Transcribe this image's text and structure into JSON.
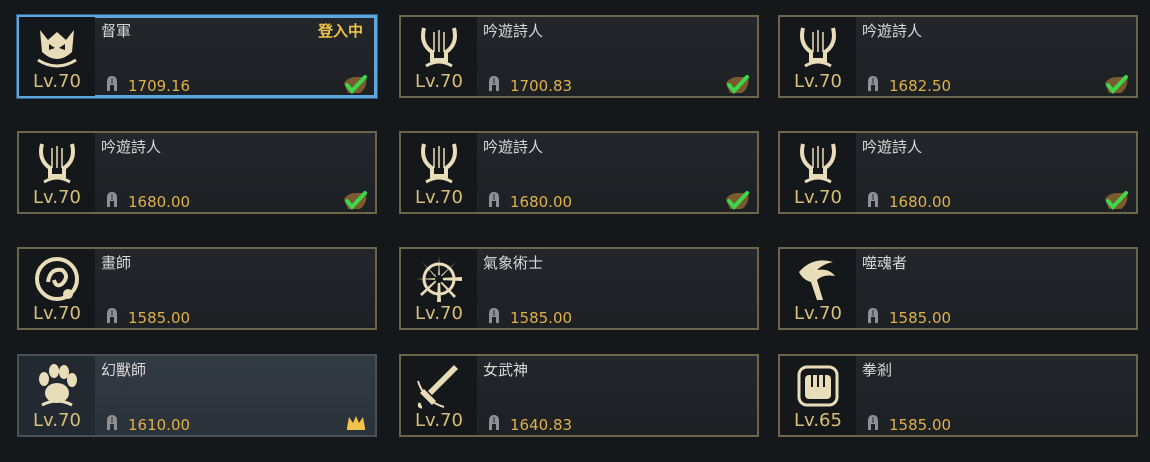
{
  "colors": {
    "background": "#15181a",
    "border_gold": "#6d6549",
    "border_selected": "#5fa6dc",
    "level_gold": "#d7bf78",
    "item_level_orange": "#e0b04a",
    "status_yellow": "#f0c24a",
    "check_green": "#3ed64a"
  },
  "characters": [
    {
      "class_name": "督軍",
      "level": "Lv.70",
      "item_level": "1709.16",
      "icon": "warlord-helm-icon",
      "status": "登入中",
      "selected": true,
      "highlight": false,
      "check": true,
      "crown": false
    },
    {
      "class_name": "吟遊詩人",
      "level": "Lv.70",
      "item_level": "1700.83",
      "icon": "lyre-icon",
      "status": "",
      "selected": false,
      "highlight": false,
      "check": true,
      "crown": false
    },
    {
      "class_name": "吟遊詩人",
      "level": "Lv.70",
      "item_level": "1682.50",
      "icon": "lyre-icon",
      "status": "",
      "selected": false,
      "highlight": false,
      "check": true,
      "crown": false
    },
    {
      "class_name": "吟遊詩人",
      "level": "Lv.70",
      "item_level": "1680.00",
      "icon": "lyre-icon",
      "status": "",
      "selected": false,
      "highlight": false,
      "check": true,
      "crown": false
    },
    {
      "class_name": "吟遊詩人",
      "level": "Lv.70",
      "item_level": "1680.00",
      "icon": "lyre-icon",
      "status": "",
      "selected": false,
      "highlight": false,
      "check": true,
      "crown": false
    },
    {
      "class_name": "吟遊詩人",
      "level": "Lv.70",
      "item_level": "1680.00",
      "icon": "lyre-icon",
      "status": "",
      "selected": false,
      "highlight": false,
      "check": true,
      "crown": false
    },
    {
      "class_name": "畫師",
      "level": "Lv.70",
      "item_level": "1585.00",
      "icon": "paint-swirl-icon",
      "status": "",
      "selected": false,
      "highlight": false,
      "check": false,
      "crown": false
    },
    {
      "class_name": "氣象術士",
      "level": "Lv.70",
      "item_level": "1585.00",
      "icon": "compass-wheel-icon",
      "status": "",
      "selected": false,
      "highlight": false,
      "check": false,
      "crown": false
    },
    {
      "class_name": "噬魂者",
      "level": "Lv.70",
      "item_level": "1585.00",
      "icon": "scythe-icon",
      "status": "",
      "selected": false,
      "highlight": false,
      "check": false,
      "crown": false
    },
    {
      "class_name": "幻獸師",
      "level": "Lv.70",
      "item_level": "1610.00",
      "icon": "beast-paw-icon",
      "status": "",
      "selected": false,
      "highlight": true,
      "check": false,
      "crown": true
    },
    {
      "class_name": "女武神",
      "level": "Lv.70",
      "item_level": "1640.83",
      "icon": "sword-icon",
      "status": "",
      "selected": false,
      "highlight": false,
      "check": false,
      "crown": false
    },
    {
      "class_name": "拳剎",
      "level": "Lv.65",
      "item_level": "1585.00",
      "icon": "fist-icon",
      "status": "",
      "selected": false,
      "highlight": false,
      "check": false,
      "crown": false
    }
  ]
}
